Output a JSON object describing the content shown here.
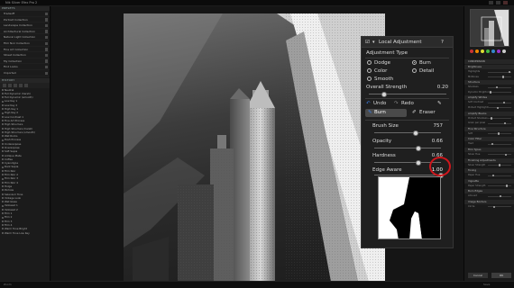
{
  "app": {
    "title": "Nik Silver Efex Pro 2"
  },
  "left_panel": {
    "section_presets_header": "PRESETS",
    "categories": [
      "Tradeoff",
      "Portrait Collection",
      "Landscape Collection",
      "Architectural Collection",
      "Natural Light Collection",
      "Film Noir Collection",
      "Fine Art Collection",
      "Street Collection",
      "My Collection",
      "Find Looks",
      "Imported"
    ],
    "section_history_header": "HISTORY",
    "presets": [
      "Neutral",
      "Full Dynamic (harsh)",
      "Full Dynamic (smooth)",
      "Low Key 1",
      "Low Key 2",
      "High Key 1",
      "High Key 2",
      "Low Contrast 1",
      "Fine Art Process",
      "High Structure",
      "High Structure (harsh)",
      "High Structure (smooth)",
      "Wet Rocks",
      "Push Process",
      "Underexpose",
      "Overexpose",
      "Soft Sepia",
      "Antique Plate",
      "Coffee",
      "Cyanotype",
      "Dark Sepia",
      "Film Noir",
      "Film Noir 2",
      "Film Noir 3",
      "Film Noir 4",
      "Holga",
      "Pinhole",
      "Selenium Tone",
      "Vintage Look",
      "Wet Glass",
      "Yellowed 1",
      "Yellowed 2",
      "Film 1",
      "Film 2",
      "Film 3",
      "Film 4",
      "Warm Tone Bright",
      "Warm Tone Low Key"
    ]
  },
  "local_panel": {
    "title": "Local Adjustment",
    "help": "?",
    "adjustment_type_label": "Adjustment Type",
    "types": [
      "Dodge",
      "Burn",
      "Color",
      "Detail",
      "Smooth"
    ],
    "overall_strength_label": "Overall Strength",
    "overall_strength_value": "0.20",
    "overall_strength_fraction": 0.2,
    "undo_label": "Undo",
    "redo_label": "Redo",
    "burn_label": "Burn",
    "eraser_label": "Eraser",
    "brush_size_label": "Brush Size",
    "brush_size_value": "757",
    "brush_size_fraction": 0.62,
    "opacity_label": "Opacity",
    "opacity_value": "0.66",
    "opacity_fraction": 0.66,
    "hardness_label": "Hardness",
    "hardness_value": "0.66",
    "hardness_fraction": 0.66,
    "edge_aware_label": "Edge Aware",
    "edge_aware_value": "1.00",
    "edge_aware_fraction": 1.0
  },
  "right_panel": {
    "sections": [
      "CONVERSION",
      "Brightness",
      "Structure",
      "Amplify Whites",
      "Amplify Blacks",
      "Fine Structure",
      "Color Filter",
      "Film Types",
      "Finishing Adjustments",
      "Toning",
      "Vignette",
      "Burn Edges",
      "Image Borders"
    ],
    "rows": [
      "Highlights",
      "Midtones",
      "Shadows",
      "Dynamic Brightness",
      "Soft Contrast",
      "Protect Highlights",
      "Protect Shadows",
      "Grain per pixel",
      "Soft",
      "Hard",
      "Silver Hue",
      "Silver Strength",
      "Paper Hue",
      "Paper Strength",
      "Amount",
      "Circle",
      "Place Center"
    ],
    "swatches": [
      "#c33",
      "#e80",
      "#dd3",
      "#4b4",
      "#38c",
      "#93c",
      "#ccc"
    ],
    "ok_label": "OK",
    "cancel_label": "Cancel"
  },
  "status": {
    "left": "Zoom",
    "right": "Save"
  }
}
